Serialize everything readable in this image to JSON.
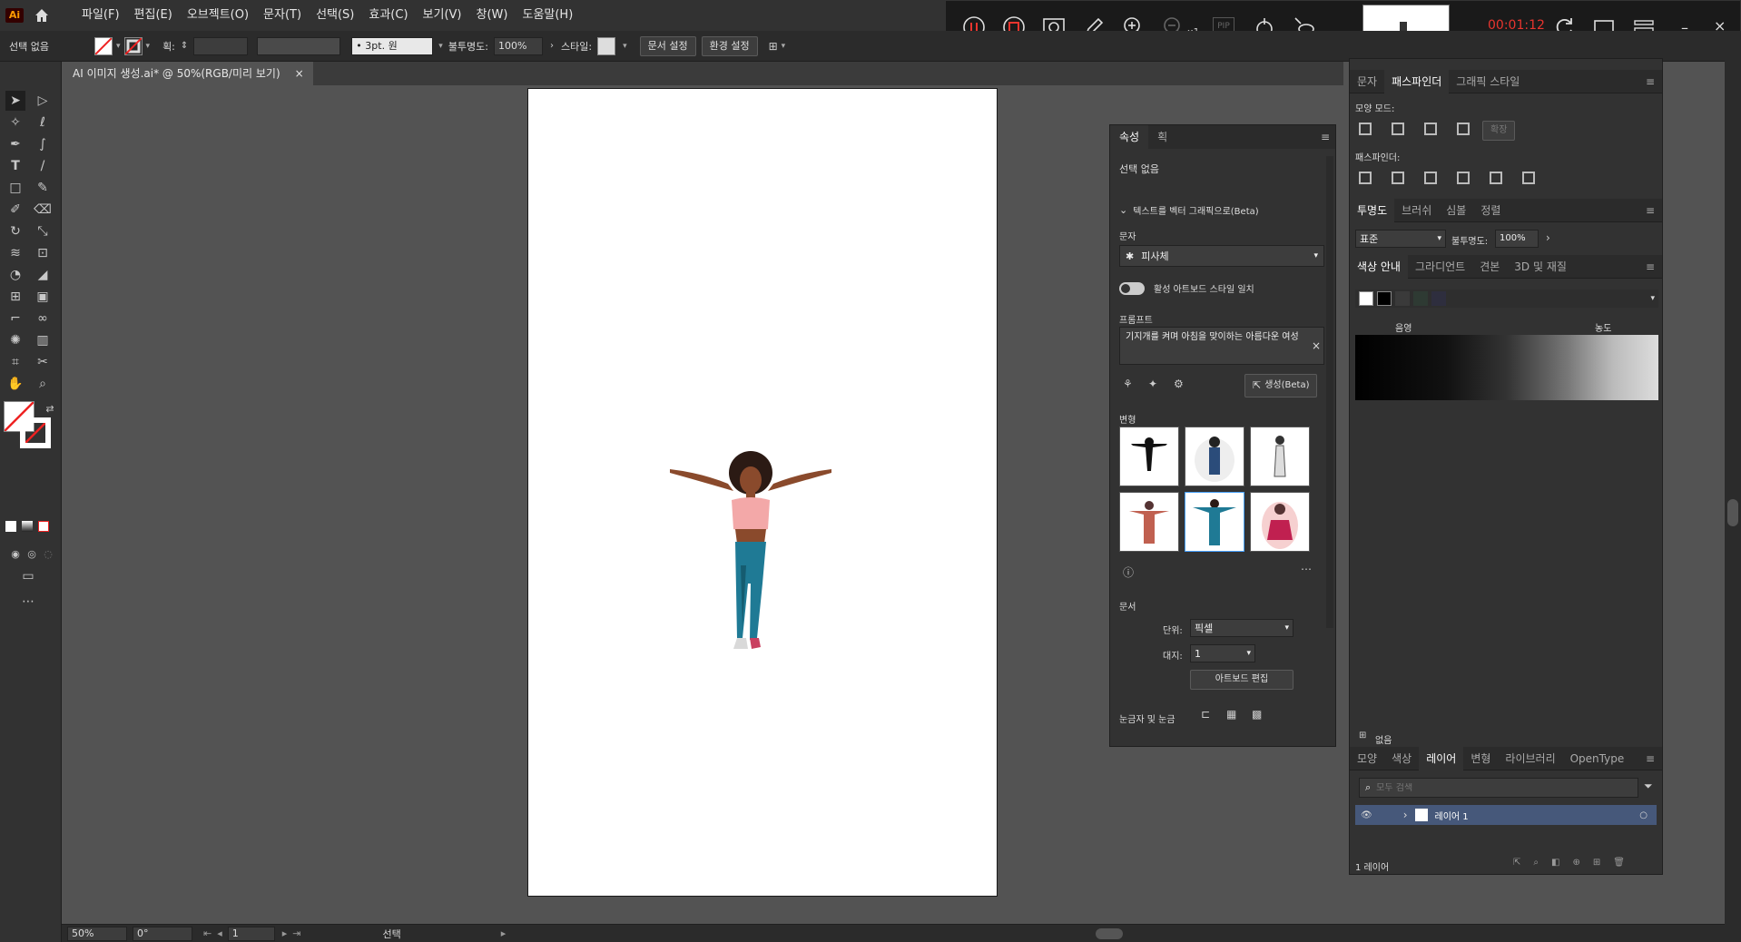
{
  "app": {
    "logo": "Ai",
    "home_icon": "home-icon"
  },
  "menu": [
    "파일(F)",
    "편집(E)",
    "오브젝트(O)",
    "문자(T)",
    "선택(S)",
    "효과(C)",
    "보기(V)",
    "창(W)",
    "도움말(H)"
  ],
  "recorder": {
    "timer": "00:01:12",
    "zoom_label": "x1",
    "pip": "PIP"
  },
  "control": {
    "selection": "선택 없음",
    "stroke_label": "획:",
    "brush": "3pt. 원",
    "opacity_label": "불투명도:",
    "opacity": "100%",
    "style_label": "스타일:",
    "doc_setup": "문서 설정",
    "prefs": "환경 설정"
  },
  "doc_tab": {
    "title": "AI 이미지 생성.ai* @ 50%(RGB/미리 보기)",
    "close": "×"
  },
  "status": {
    "zoom": "50%",
    "rotate": "0°",
    "artboard": "1",
    "tool": "선택"
  },
  "properties": {
    "tabs": [
      "속성",
      "획"
    ],
    "no_selection": "선택 없음",
    "section": "텍스트를 벡터 그래픽으로(Beta)",
    "type_label": "문자",
    "type_value": "피사체",
    "toggle_label": "활성 아트보드 스타일 일치",
    "prompt_label": "프롬프트",
    "prompt": "기지개를 켜며 아침을 맞이하는 아름다운 여성",
    "generate": "생성(Beta)",
    "variations_label": "변형",
    "document_label": "문서",
    "unit_label": "단위:",
    "unit": "픽셀",
    "artboard_label": "대지:",
    "artboard_value": "1",
    "edit_artboard": "아트보드 편집",
    "rulers_label": "눈금자 및 눈금"
  },
  "right_panel": {
    "tabs1": [
      "문자",
      "패스파인더",
      "그래픽 스타일"
    ],
    "shape_modes": "모양 모드:",
    "expand": "확장",
    "pathfinder": "패스파인더:",
    "tabs2": [
      "투명도",
      "브러쉬",
      "심볼",
      "정렬"
    ],
    "blend": "표준",
    "opacity_label": "불투명도:",
    "opacity": "100%",
    "tabs3": [
      "색상 안내",
      "그라디언트",
      "견본",
      "3D 및 재질"
    ],
    "shade_label": "음영",
    "saturation_label": "농도",
    "none_label": "없음",
    "tabs4": [
      "모양",
      "색상",
      "레이어",
      "변형",
      "라이브러리",
      "OpenType"
    ],
    "search_placeholder": "모두 검색",
    "layer_name": "레이어 1",
    "layer_count": "1 레이어"
  },
  "colors": {
    "accent": "#46587a",
    "timer": "#e8352e",
    "logo": "#ff9a00"
  }
}
